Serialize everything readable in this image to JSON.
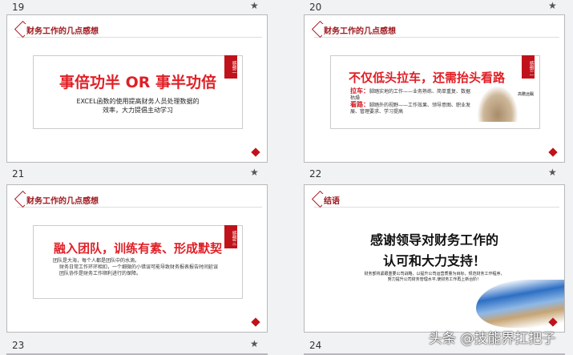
{
  "slides": [
    {
      "number": "19",
      "header": "财务工作的几点感想",
      "tag": "感想一",
      "title": "事倍功半 OR 事半功倍",
      "body": [
        "EXCEL函数的使用提高财务人员处理数据的",
        "效率，大力提倡主动学习"
      ]
    },
    {
      "number": "20",
      "header": "财务工作的几点感想",
      "tag": "感想二",
      "title": "不仅低头拉车，还需抬头看路",
      "items": [
        {
          "label": "拉车：",
          "text": "脚踏实地的工作——业务熟练、简单重复、数据枯燥"
        },
        {
          "label": "看路：",
          "text": "脚踏外的视野——工作效果、领导意图、职业发展、管理要求、学习提高"
        }
      ],
      "image_caption": "高瞻远瞩"
    },
    {
      "number": "21",
      "header": "财务工作的几点感想",
      "tag": "感想三",
      "title": "融入团队，训练有素、形成默契",
      "body": [
        "团队是大海，每个人都是团队中的水滴。",
        "财务日常工作环环相扣，一个细微的小错误可能导致财务报表报告时间延误",
        "团队协作是财务工作顺利进行的保障。"
      ]
    },
    {
      "number": "22",
      "header": "结语",
      "title_lines": [
        "感谢领导对财务工作的",
        "认可和大力支持！"
      ],
      "body": [
        "财务部将紧跟重要公司战略，以提升公司运营质量为目标，规范财务工作程序，",
        "努力提升公司财务管理水平,使财务工作再上新台阶！"
      ]
    }
  ],
  "next_numbers": [
    "23",
    "24"
  ],
  "watermark": "头条 @技能界扛把子"
}
